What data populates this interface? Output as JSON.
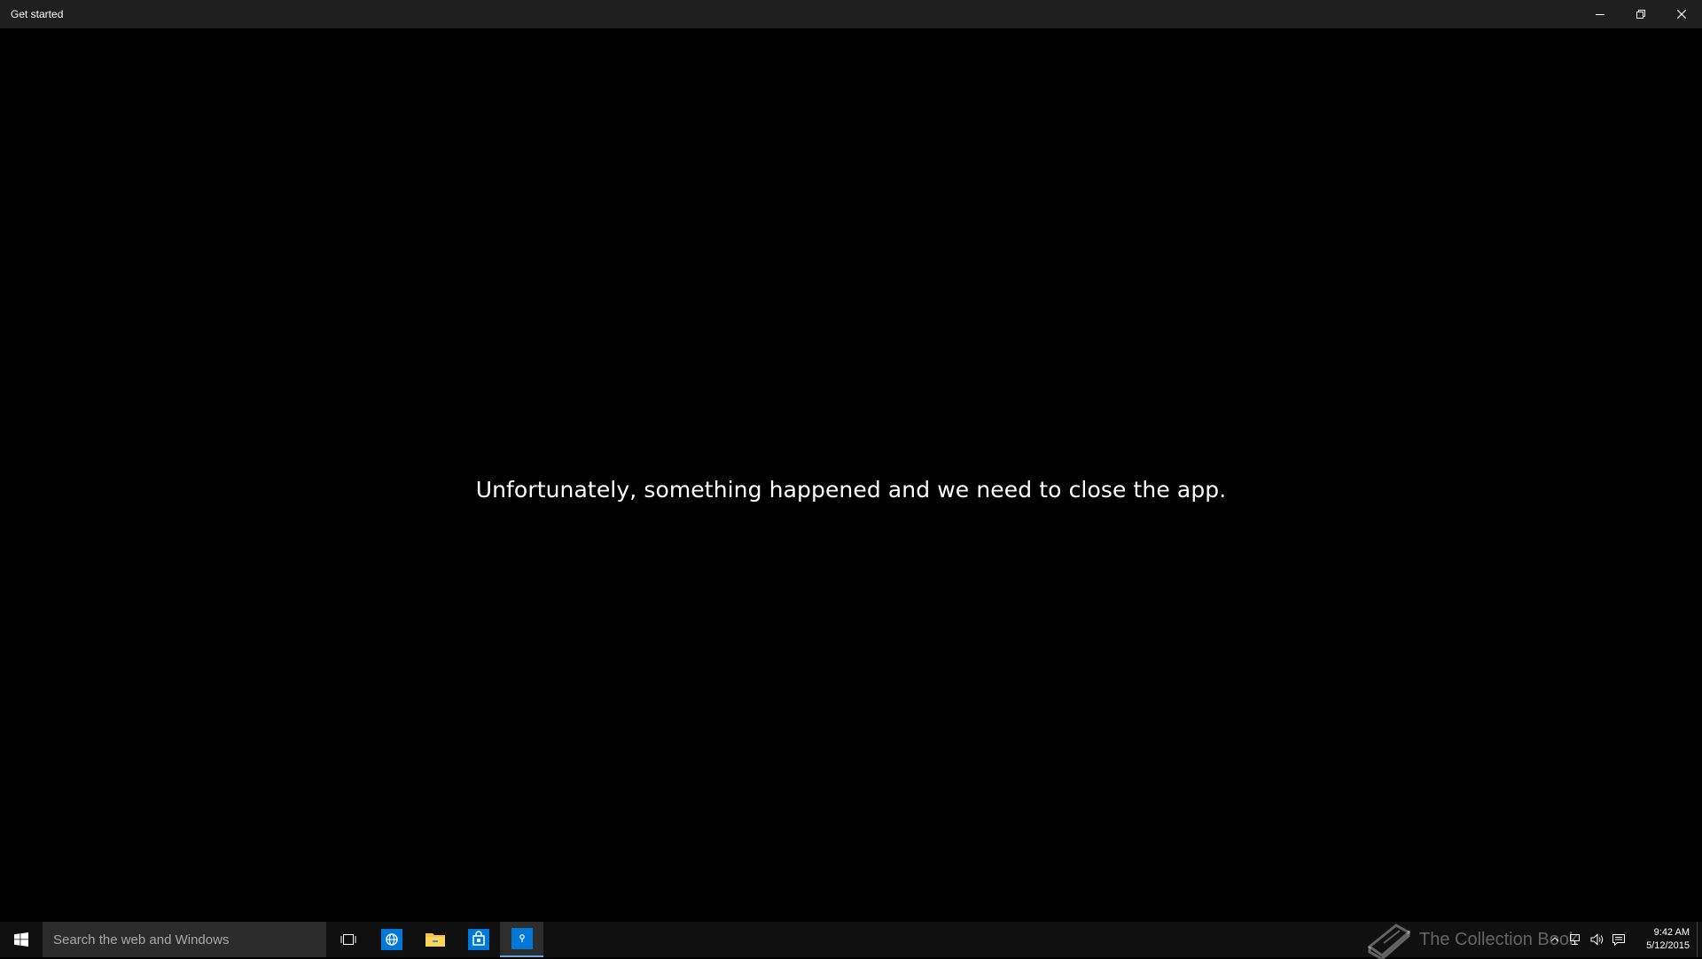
{
  "window": {
    "title": "Get started"
  },
  "content": {
    "message": "Unfortunately, something happened and we need to close the app."
  },
  "taskbar": {
    "search_placeholder": "Search the web and Windows",
    "apps": [
      {
        "name": "task-view",
        "icon": "task-view-icon"
      },
      {
        "name": "internet-explorer",
        "icon": "ie-icon"
      },
      {
        "name": "file-explorer",
        "icon": "folder-icon"
      },
      {
        "name": "store",
        "icon": "store-icon"
      },
      {
        "name": "get-started",
        "icon": "tips-icon",
        "active": true
      }
    ],
    "watermark_text": "The Collection Book",
    "clock_time": "9:42 AM",
    "clock_date": "5/12/2015"
  },
  "colors": {
    "titlebar": "#1f1f1f",
    "background": "#000000",
    "taskbar": "#101010",
    "accent": "#0078d7"
  }
}
